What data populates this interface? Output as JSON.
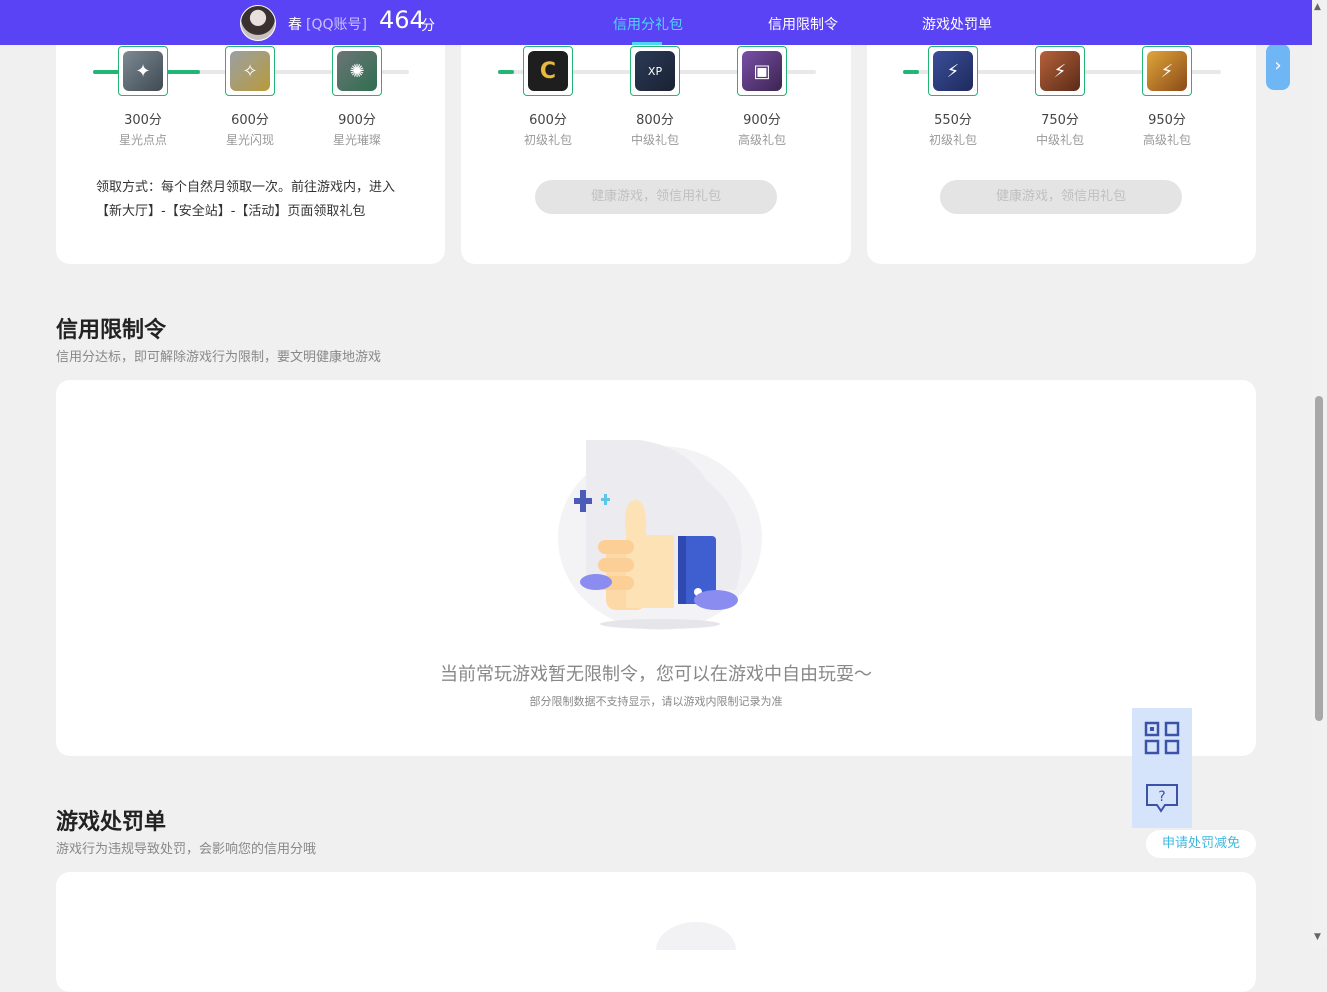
{
  "header": {
    "user_name": "春",
    "account_type": "[QQ账号]",
    "score": "464",
    "score_unit": "分",
    "nav": [
      {
        "label": "信用分礼包",
        "active": true
      },
      {
        "label": "信用限制令",
        "active": false
      },
      {
        "label": "游戏处罚单",
        "active": false
      }
    ]
  },
  "gift_cards": [
    {
      "progress_fraction": 0.33,
      "rewards": [
        {
          "score": "300分",
          "name": "星光点点",
          "icon": "star-gear-icon"
        },
        {
          "score": "600分",
          "name": "星光闪现",
          "icon": "star-flash-icon"
        },
        {
          "score": "900分",
          "name": "星光璀璨",
          "icon": "star-brilliant-icon"
        }
      ],
      "claim_text": "领取方式：每个自然月领取一次。前往游戏内，进入【新大厅】-【安全站】-【活动】页面领取礼包"
    },
    {
      "progress_fraction": 0.0,
      "rewards": [
        {
          "score": "600分",
          "name": "初级礼包",
          "icon": "c-badge-icon"
        },
        {
          "score": "800分",
          "name": "中级礼包",
          "icon": "xp-card-icon"
        },
        {
          "score": "900分",
          "name": "高级礼包",
          "icon": "chest-icon"
        }
      ],
      "button_label": "健康游戏，领信用礼包"
    },
    {
      "progress_fraction": 0.0,
      "rewards": [
        {
          "score": "550分",
          "name": "初级礼包",
          "icon": "blue-emblem-icon"
        },
        {
          "score": "750分",
          "name": "中级礼包",
          "icon": "bronze-emblem-icon"
        },
        {
          "score": "950分",
          "name": "高级礼包",
          "icon": "gold-emblem-icon"
        }
      ],
      "button_label": "健康游戏，领信用礼包"
    }
  ],
  "restriction": {
    "title": "信用限制令",
    "subtitle": "信用分达标，即可解除游戏行为限制，要文明健康地游戏",
    "empty_main": "当前常玩游戏暂无限制令，您可以在游戏中自由玩耍～",
    "empty_sub": "部分限制数据不支持显示，请以游戏内限制记录为准"
  },
  "punishment": {
    "title": "游戏处罚单",
    "subtitle": "游戏行为违规导致处罚，会影响您的信用分哦",
    "appeal_label": "申请处罚减免"
  },
  "floating": {
    "qr_icon": "qr-code-icon",
    "help_icon": "help-chat-icon"
  },
  "colors": {
    "brand": "#5a43f5",
    "accent": "#4fd6f5",
    "progress": "#22b573"
  }
}
